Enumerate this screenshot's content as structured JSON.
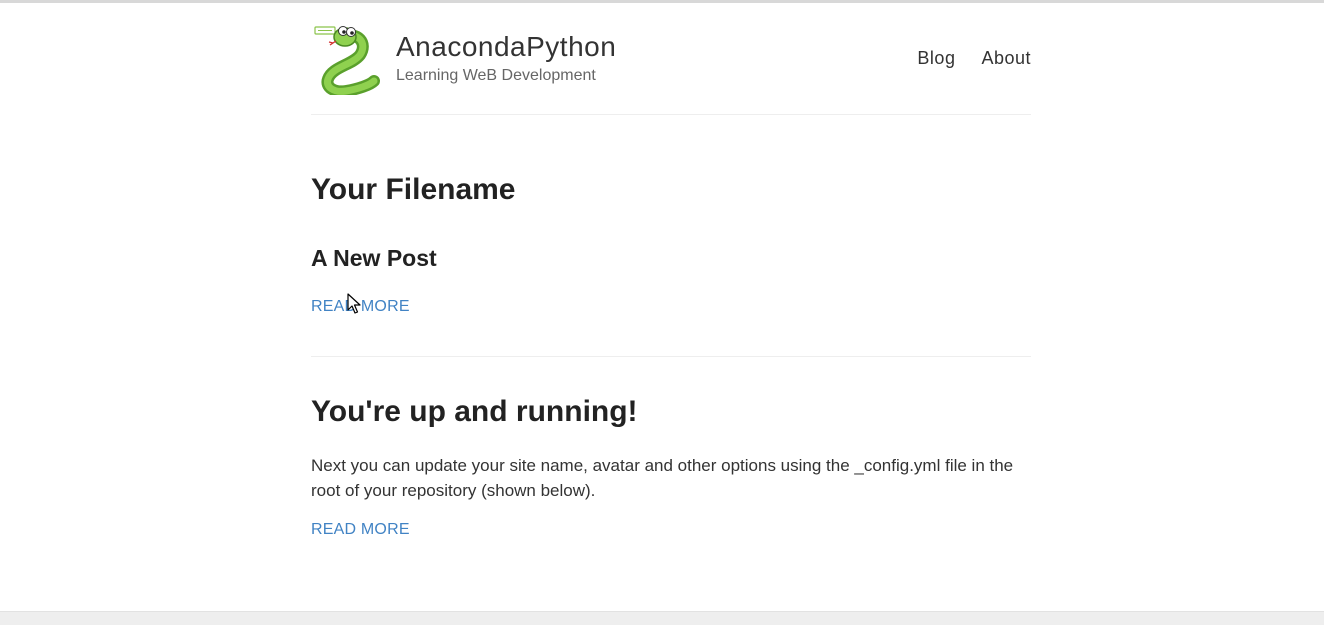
{
  "site": {
    "name": "AnacondaPython",
    "description": "Learning WeB Development",
    "avatar_icon": "snake-logo-icon"
  },
  "nav": {
    "items": [
      {
        "label": "Blog"
      },
      {
        "label": "About"
      }
    ]
  },
  "content": {
    "section_title": "Your Filename",
    "posts": [
      {
        "title": "A New Post",
        "read_more": "READ MORE"
      },
      {
        "title": "You're up and running!",
        "excerpt": "Next you can update your site name, avatar and other options using the _config.yml file in the root of your repository (shown below).",
        "read_more": "READ MORE"
      }
    ]
  },
  "colors": {
    "link": "#4183c4",
    "text": "#222222",
    "muted": "#666666",
    "rule": "#eeeeee"
  }
}
